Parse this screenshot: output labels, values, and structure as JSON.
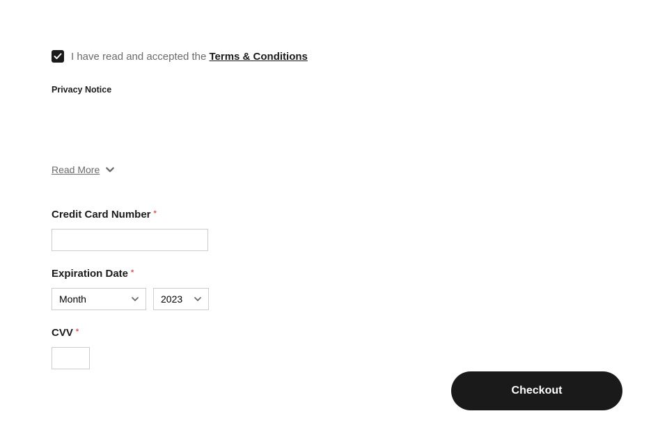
{
  "terms": {
    "checkbox_checked": true,
    "prefix": "I have read and accepted the ",
    "link": "Terms & Conditions"
  },
  "privacy": {
    "heading": "Privacy Notice",
    "read_more": "Read More"
  },
  "payment": {
    "credit_card_label": "Credit Card Number",
    "expiration_label": "Expiration Date",
    "cvv_label": "CVV",
    "month_placeholder": "Month",
    "year_value": "2023"
  },
  "actions": {
    "checkout": "Checkout"
  }
}
